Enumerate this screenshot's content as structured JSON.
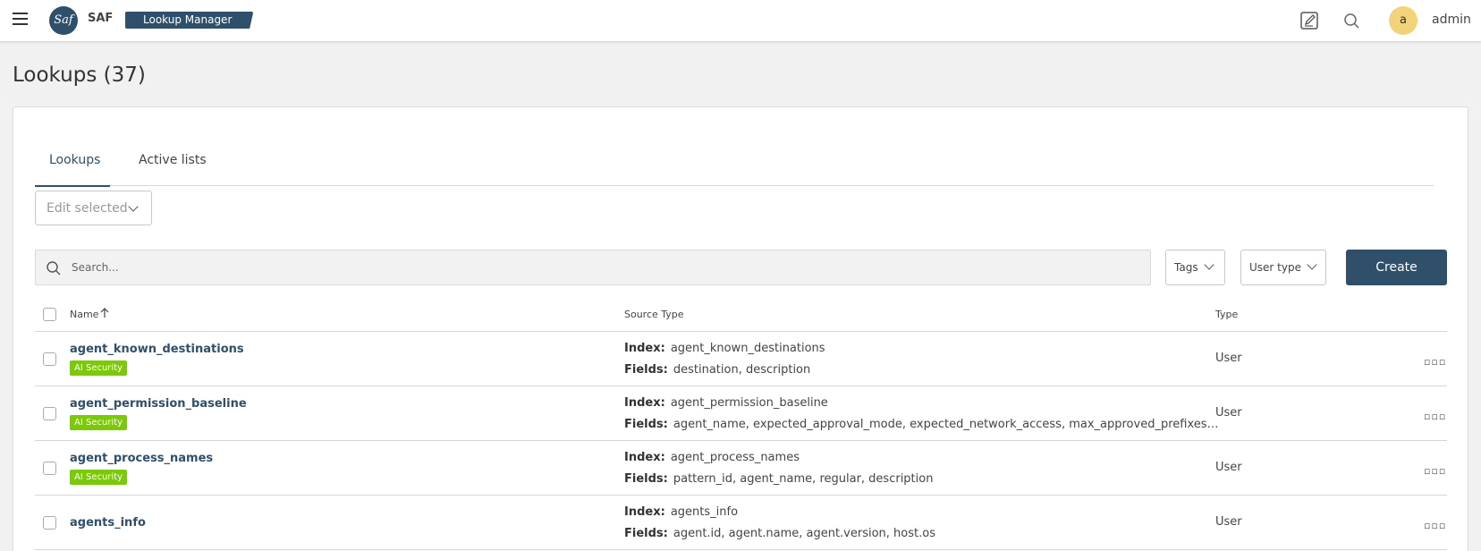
{
  "header": {
    "brand": "SAF",
    "app_name": "Lookup Manager",
    "logo_text": "Saf",
    "avatar_initial": "a",
    "username": "admin"
  },
  "page": {
    "title": "Lookups (37)"
  },
  "tabs": [
    {
      "label": "Lookups",
      "active": true
    },
    {
      "label": "Active lists",
      "active": false
    }
  ],
  "toolbar": {
    "edit_selected": "Edit selected",
    "search_placeholder": "Search...",
    "tags_filter": "Tags",
    "user_type_filter": "User type",
    "create_label": "Create"
  },
  "table": {
    "columns": {
      "name": "Name",
      "source_type": "Source Type",
      "type": "Type"
    },
    "sort": {
      "column": "Name",
      "direction": "ascending"
    },
    "index_label": "Index:",
    "fields_label": "Fields:",
    "rows": [
      {
        "name": "agent_known_destinations",
        "tag": "AI Security",
        "index": "agent_known_destinations",
        "fields": "destination, description",
        "type": "User"
      },
      {
        "name": "agent_permission_baseline",
        "tag": "AI Security",
        "index": "agent_permission_baseline",
        "fields": "agent_name, expected_approval_mode, expected_network_access, max_approved_prefixes_count,...",
        "type": "User"
      },
      {
        "name": "agent_process_names",
        "tag": "AI Security",
        "index": "agent_process_names",
        "fields": "pattern_id, agent_name, regular, description",
        "type": "User"
      },
      {
        "name": "agents_info",
        "tag": "",
        "index": "agents_info",
        "fields": "agent.id, agent.name, agent.version, host.os",
        "type": "User"
      }
    ]
  },
  "colors": {
    "primary": "#2f4f6a",
    "tag_green": "#7cc80a",
    "avatar_yellow": "#f2d37a"
  }
}
